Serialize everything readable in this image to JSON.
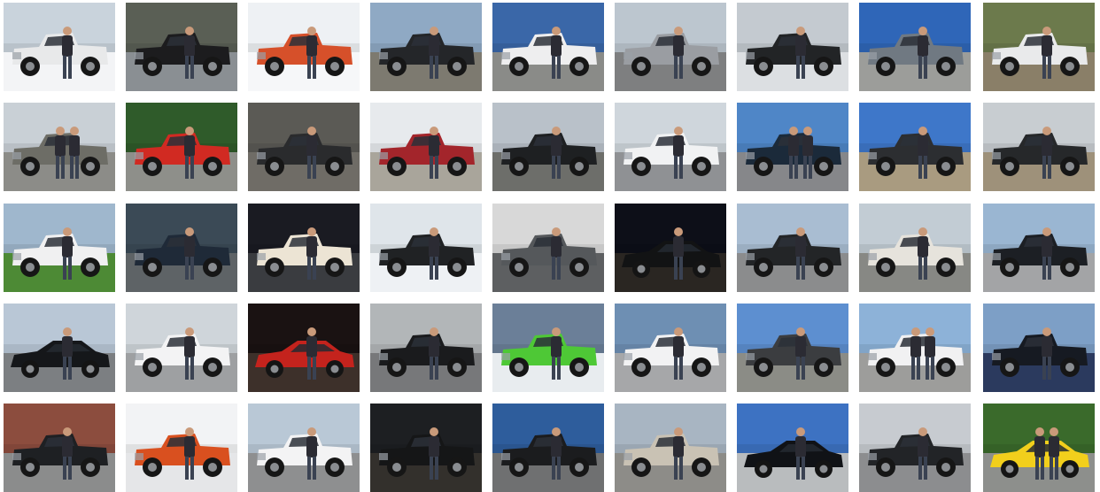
{
  "gallery": {
    "rows": 5,
    "columns": 9,
    "photos": [
      {
        "subject": "truck",
        "vehicle": "#e8e9ea",
        "sky": "#c9d3dc",
        "ground": "#f3f4f6",
        "people": 1
      },
      {
        "subject": "truck",
        "vehicle": "#1c1c1e",
        "sky": "#5a5f55",
        "ground": "#8a8f93",
        "people": 1
      },
      {
        "subject": "truck",
        "vehicle": "#d6502a",
        "sky": "#eef1f4",
        "ground": "#f6f7f9",
        "people": 1
      },
      {
        "subject": "truck",
        "vehicle": "#242629",
        "sky": "#8fa9c4",
        "ground": "#7d7a70",
        "people": 1
      },
      {
        "subject": "truck",
        "vehicle": "#eeeeef",
        "sky": "#3a67a8",
        "ground": "#8a8b88",
        "people": 1
      },
      {
        "subject": "truck",
        "vehicle": "#9a9da2",
        "sky": "#bcc6cf",
        "ground": "#7e7f80",
        "people": 1
      },
      {
        "subject": "truck",
        "vehicle": "#222426",
        "sky": "#c4cad0",
        "ground": "#dcdfe2",
        "people": 1
      },
      {
        "subject": "truck",
        "vehicle": "#707982",
        "sky": "#2f66b8",
        "ground": "#9c9d9a",
        "people": 1
      },
      {
        "subject": "truck",
        "vehicle": "#e9eaeb",
        "sky": "#6c7a4c",
        "ground": "#8a7f68",
        "people": 1
      },
      {
        "subject": "truck",
        "vehicle": "#6d6d66",
        "sky": "#c9d0d6",
        "ground": "#8c8c88",
        "people": 2
      },
      {
        "subject": "truck",
        "vehicle": "#d12a22",
        "sky": "#2f5b2a",
        "ground": "#8e8f8a",
        "people": 1
      },
      {
        "subject": "truck",
        "vehicle": "#2a2b2d",
        "sky": "#5b5a55",
        "ground": "#6f6c66",
        "people": 1
      },
      {
        "subject": "truck",
        "vehicle": "#a3252b",
        "sky": "#e7eaed",
        "ground": "#a9a59b",
        "people": 1
      },
      {
        "subject": "truck",
        "vehicle": "#1e2022",
        "sky": "#b9c1c9",
        "ground": "#6d6e6a",
        "people": 1
      },
      {
        "subject": "truck",
        "vehicle": "#f1f2f3",
        "sky": "#cfd6dc",
        "ground": "#8f9194",
        "people": 1
      },
      {
        "subject": "truck",
        "vehicle": "#1b2a3a",
        "sky": "#4f86c7",
        "ground": "#86878a",
        "people": 2
      },
      {
        "subject": "truck",
        "vehicle": "#2c2e31",
        "sky": "#3e77c9",
        "ground": "#a99b80",
        "people": 1
      },
      {
        "subject": "truck",
        "vehicle": "#26282a",
        "sky": "#c8cdd1",
        "ground": "#9e917a",
        "people": 1
      },
      {
        "subject": "truck",
        "vehicle": "#f0f0f1",
        "sky": "#9fb7cd",
        "ground": "#4d8a35",
        "people": 1
      },
      {
        "subject": "truck",
        "vehicle": "#1f2a38",
        "sky": "#3b4a56",
        "ground": "#5e6366",
        "people": 1
      },
      {
        "subject": "truck",
        "vehicle": "#ece4d4",
        "sky": "#1a1b22",
        "ground": "#3a3c40",
        "people": 1
      },
      {
        "subject": "truck",
        "vehicle": "#202224",
        "sky": "#dfe5ea",
        "ground": "#eef1f4",
        "people": 1
      },
      {
        "subject": "truck",
        "vehicle": "#55585b",
        "sky": "#d8d8d8",
        "ground": "#5d5f61",
        "people": 1
      },
      {
        "subject": "car",
        "vehicle": "#121314",
        "sky": "#0d0f18",
        "ground": "#2a2622",
        "people": 1
      },
      {
        "subject": "truck",
        "vehicle": "#232527",
        "sky": "#a9bdd2",
        "ground": "#8b8c8d",
        "people": 1
      },
      {
        "subject": "truck",
        "vehicle": "#e6e3dc",
        "sky": "#c2ccd4",
        "ground": "#878884",
        "people": 1
      },
      {
        "subject": "truck",
        "vehicle": "#1c1f24",
        "sky": "#9ab6d2",
        "ground": "#a3a4a6",
        "people": 1
      },
      {
        "subject": "car",
        "vehicle": "#15171a",
        "sky": "#b9c7d6",
        "ground": "#7c7f82",
        "people": 1
      },
      {
        "subject": "truck",
        "vehicle": "#f3f3f4",
        "sky": "#cfd5da",
        "ground": "#9ea0a2",
        "people": 1
      },
      {
        "subject": "car",
        "vehicle": "#c4231d",
        "sky": "#1a1212",
        "ground": "#3d302a",
        "people": 1
      },
      {
        "subject": "truck",
        "vehicle": "#1a1b1d",
        "sky": "#b2b6b8",
        "ground": "#77787a",
        "people": 1
      },
      {
        "subject": "truck",
        "vehicle": "#4ec836",
        "sky": "#6b7f98",
        "ground": "#e8ecef",
        "people": 1
      },
      {
        "subject": "truck",
        "vehicle": "#f2f2f3",
        "sky": "#6e8fb3",
        "ground": "#a6a7a9",
        "people": 1
      },
      {
        "subject": "truck",
        "vehicle": "#3b3d40",
        "sky": "#5d8fd0",
        "ground": "#8b8c86",
        "people": 1
      },
      {
        "subject": "truck",
        "vehicle": "#f1f1f2",
        "sky": "#8db2d8",
        "ground": "#9d9d9b",
        "people": 2
      },
      {
        "subject": "truck",
        "vehicle": "#161a22",
        "sky": "#7d9fc6",
        "ground": "#2b3a5e",
        "people": 1
      },
      {
        "subject": "truck",
        "vehicle": "#1e2023",
        "sky": "#8c4d3e",
        "ground": "#8b8c8c",
        "people": 1
      },
      {
        "subject": "truck",
        "vehicle": "#d9501f",
        "sky": "#f2f3f5",
        "ground": "#e5e6e8",
        "people": 1
      },
      {
        "subject": "truck",
        "vehicle": "#f3f3f4",
        "sky": "#b9c8d6",
        "ground": "#8e8f90",
        "people": 1
      },
      {
        "subject": "truck",
        "vehicle": "#151617",
        "sky": "#1d1f22",
        "ground": "#33302c",
        "people": 1
      },
      {
        "subject": "truck",
        "vehicle": "#1b1c1e",
        "sky": "#2e5d9c",
        "ground": "#6f7071",
        "people": 1
      },
      {
        "subject": "truck",
        "vehicle": "#c9c2b4",
        "sky": "#a8b5c2",
        "ground": "#8d8c88",
        "people": 1
      },
      {
        "subject": "car",
        "vehicle": "#101216",
        "sky": "#3d72c2",
        "ground": "#b9bcbe",
        "people": 1
      },
      {
        "subject": "truck",
        "vehicle": "#222427",
        "sky": "#c7cbd0",
        "ground": "#8c8d8f",
        "people": 1
      },
      {
        "subject": "car",
        "vehicle": "#f2cf1c",
        "sky": "#3a6a2b",
        "ground": "#8d8f8c",
        "people": 2
      }
    ]
  }
}
